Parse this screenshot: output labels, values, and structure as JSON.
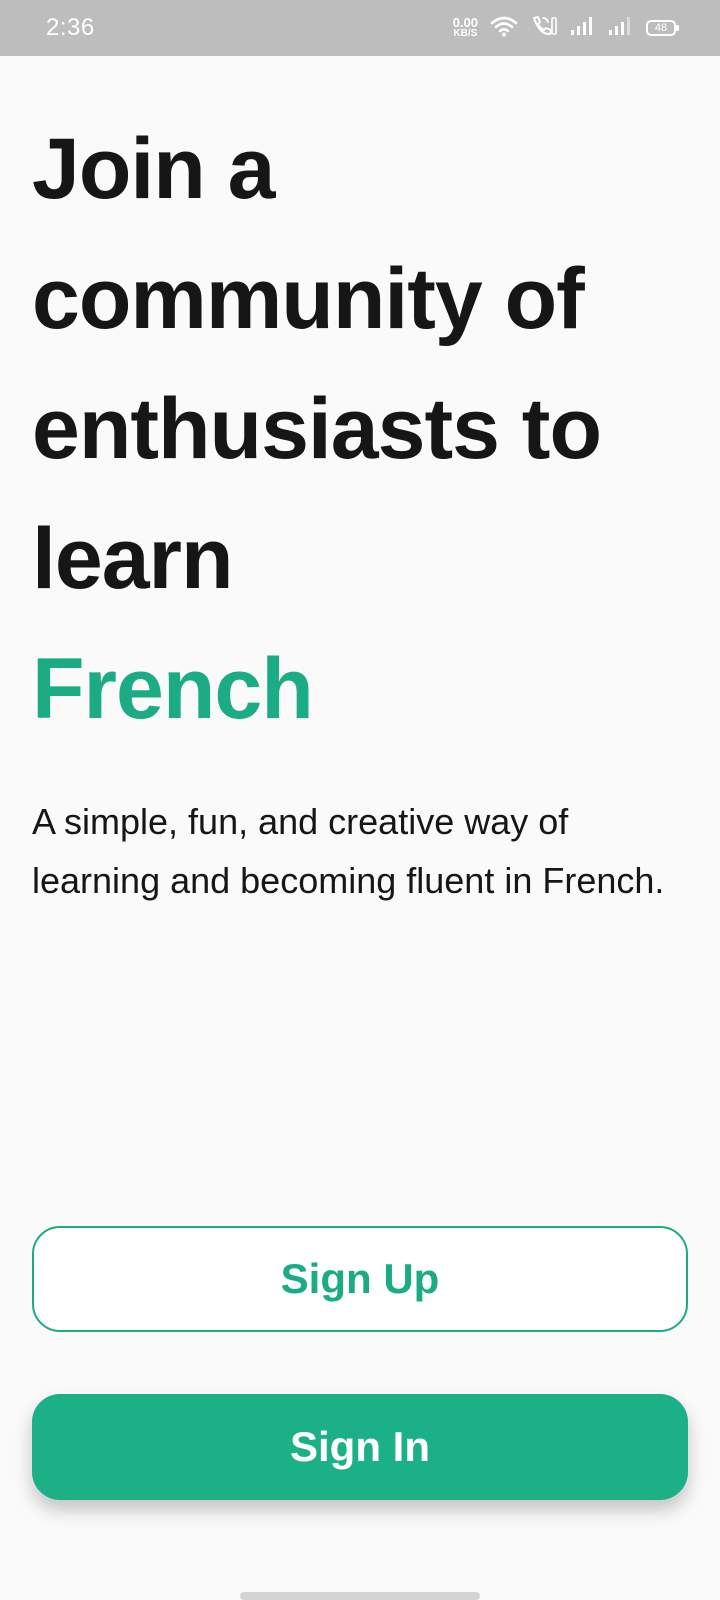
{
  "status_bar": {
    "time": "2:36",
    "net_speed_value": "0.00",
    "net_speed_unit": "KB/S",
    "battery_level": "48",
    "icons": [
      "wifi-icon",
      "volte-call-icon",
      "signal-bars-icon",
      "signal-bars-icon",
      "battery-icon"
    ]
  },
  "hero": {
    "headline_line1": "Join a",
    "headline_line2": "community of",
    "headline_line3": "enthusiasts to",
    "headline_line4": "learn",
    "headline_accent": "French",
    "subtitle": "A simple, fun, and creative way of learning and becoming fluent in French."
  },
  "actions": {
    "signup_label": "Sign Up",
    "signin_label": "Sign In"
  },
  "colors": {
    "accent": "#1bab85",
    "status_bar": "#bdbdbd",
    "background": "#fafafa",
    "text": "#161616"
  }
}
